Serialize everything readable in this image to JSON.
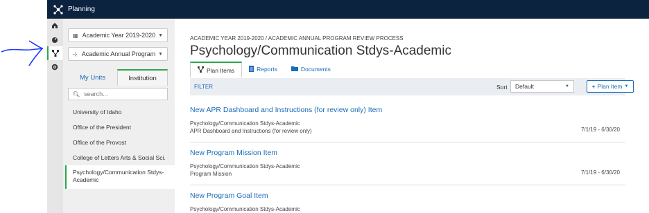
{
  "app": {
    "title": "Planning"
  },
  "rail": {
    "icons": [
      "home-icon",
      "dashboard-icon",
      "planning-icon",
      "settings-icon"
    ],
    "active": "planning-icon"
  },
  "left": {
    "year_select": "Academic Year 2019-2020",
    "process_select": "Academic Annual Program R",
    "tabs": [
      "My Units",
      "Institution"
    ],
    "active_tab": "Institution",
    "search_placeholder": "search...",
    "units": [
      "University of Idaho",
      "Office of the President",
      "Office of the Provost",
      "College of Letters Arts & Social Sci.",
      "Psychology/Communication Stdys-Academic"
    ],
    "selected_unit": "Psychology/Communication Stdys-Academic"
  },
  "main": {
    "breadcrumb": "ACADEMIC YEAR 2019-2020 / ACADEMIC ANNUAL PROGRAM REVIEW PROCESS",
    "title": "Psychology/Communication Stdys-Academic",
    "tabs": [
      "Plan Items",
      "Reports",
      "Documents"
    ],
    "active_tab": "Plan Items",
    "filter_label": "FILTER",
    "sort_label": "Sort",
    "sort_value": "Default",
    "add_button": "Plan Item",
    "items": [
      {
        "title": "New APR Dashboard and Instructions (for review only) Item",
        "unit": "Psychology/Communication Stdys-Academic",
        "type": "APR Dashboard and Instructions (for review only)",
        "dates": "7/1/19 - 6/30/20"
      },
      {
        "title": "New Program Mission Item",
        "unit": "Psychology/Communication Stdys-Academic",
        "type": "Program Mission",
        "dates": "7/1/19 - 6/30/20"
      },
      {
        "title": "New Program Goal Item",
        "unit": "Psychology/Communication Stdys-Academic",
        "type": "",
        "dates": ""
      }
    ]
  },
  "colors": {
    "topbar": "#0c2340",
    "accent_green": "#2ba84a",
    "link_blue": "#1b6bb8",
    "annotation_blue": "#1f3cff"
  }
}
